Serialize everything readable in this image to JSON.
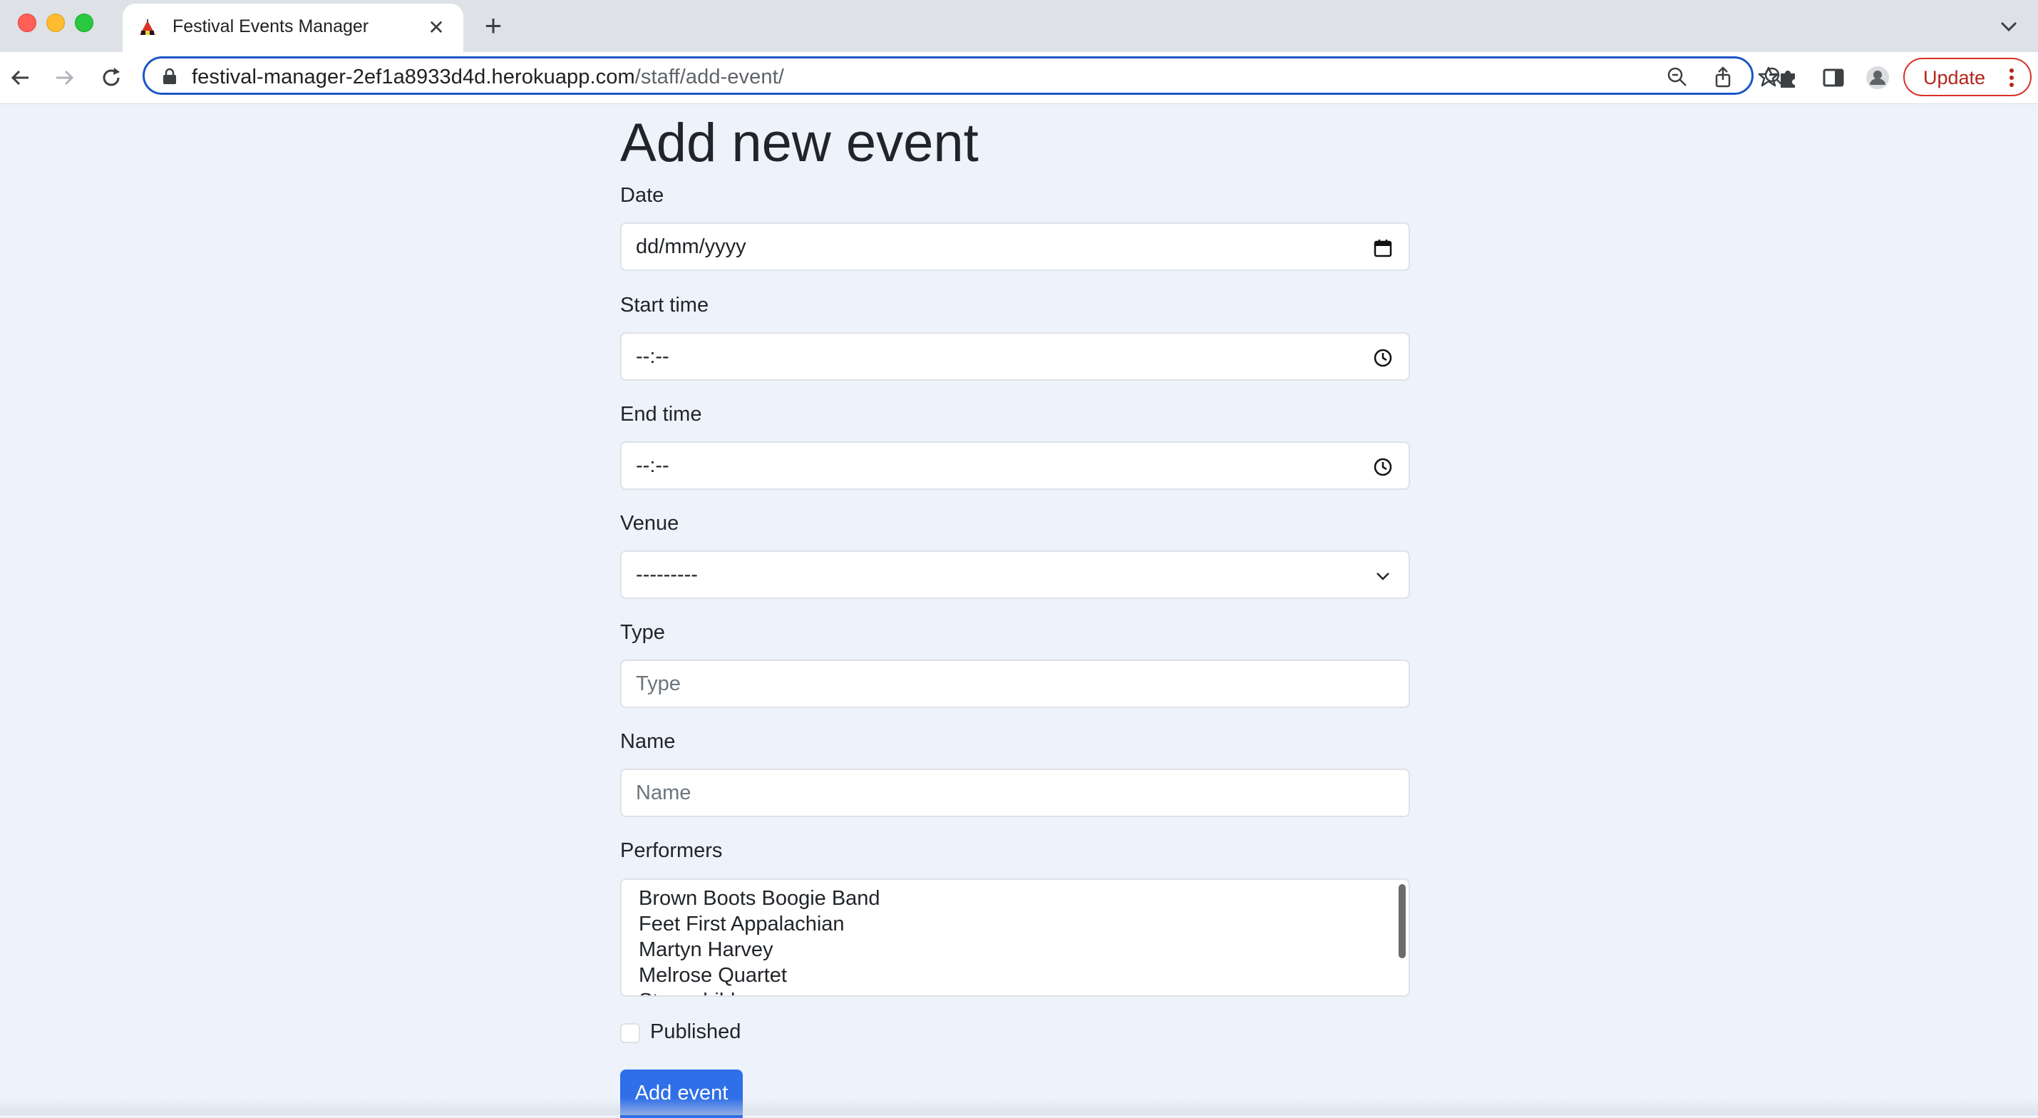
{
  "browser": {
    "tab_title": "Festival Events Manager",
    "url_host": "festival-manager-2ef1a8933d4d.herokuapp.com",
    "url_path": "/staff/add-event/",
    "update_label": "Update"
  },
  "page": {
    "title": "Add new event",
    "fields": {
      "date": {
        "label": "Date",
        "value": "dd/mm/yyyy"
      },
      "start_time": {
        "label": "Start time",
        "value": "--:--"
      },
      "end_time": {
        "label": "End time",
        "value": "--:--"
      },
      "venue": {
        "label": "Venue",
        "value": "---------"
      },
      "type": {
        "label": "Type",
        "placeholder": "Type"
      },
      "name": {
        "label": "Name",
        "placeholder": "Name"
      },
      "performers": {
        "label": "Performers",
        "options": [
          "Brown Boots Boogie Band",
          "Feet First Appalachian",
          "Martyn Harvey",
          "Melrose Quartet",
          "Stonechild"
        ]
      }
    },
    "published_label": "Published",
    "submit_label": "Add event"
  }
}
